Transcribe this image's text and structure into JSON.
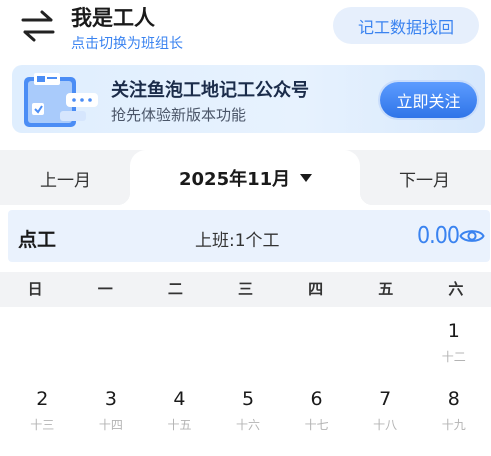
{
  "header": {
    "role_title": "我是工人",
    "role_switch_hint": "点击切换为班组长",
    "recover_button": "记工数据找回"
  },
  "banner": {
    "title": "关注鱼泡工地记工公众号",
    "subtitle": "抢先体验新版本功能",
    "button": "立即关注"
  },
  "month_nav": {
    "prev": "上一月",
    "current": "2025年11月",
    "next": "下一月"
  },
  "summary": {
    "type": "点工",
    "detail": "上班:1个工",
    "amount": "0.00"
  },
  "weekdays": [
    "日",
    "一",
    "二",
    "三",
    "四",
    "五",
    "六"
  ],
  "calendar": {
    "week1": [
      {
        "day": "",
        "lunar": ""
      },
      {
        "day": "",
        "lunar": ""
      },
      {
        "day": "",
        "lunar": ""
      },
      {
        "day": "",
        "lunar": ""
      },
      {
        "day": "",
        "lunar": ""
      },
      {
        "day": "",
        "lunar": ""
      },
      {
        "day": "1",
        "lunar": "十二"
      }
    ],
    "week2": [
      {
        "day": "2",
        "lunar": "十三"
      },
      {
        "day": "3",
        "lunar": "十四"
      },
      {
        "day": "4",
        "lunar": "十五"
      },
      {
        "day": "5",
        "lunar": "十六"
      },
      {
        "day": "6",
        "lunar": "十七"
      },
      {
        "day": "7",
        "lunar": "十八"
      },
      {
        "day": "8",
        "lunar": "十九"
      }
    ]
  },
  "colors": {
    "accent": "#3a83f0",
    "summary_bg": "#eaf2fd",
    "bar_bg": "#f2f3f5",
    "lunar_text": "#b4b4b4"
  },
  "icons": {
    "switch": "swap-arrows-icon",
    "visibility": "eye-icon",
    "dropdown": "caret-down-icon"
  }
}
